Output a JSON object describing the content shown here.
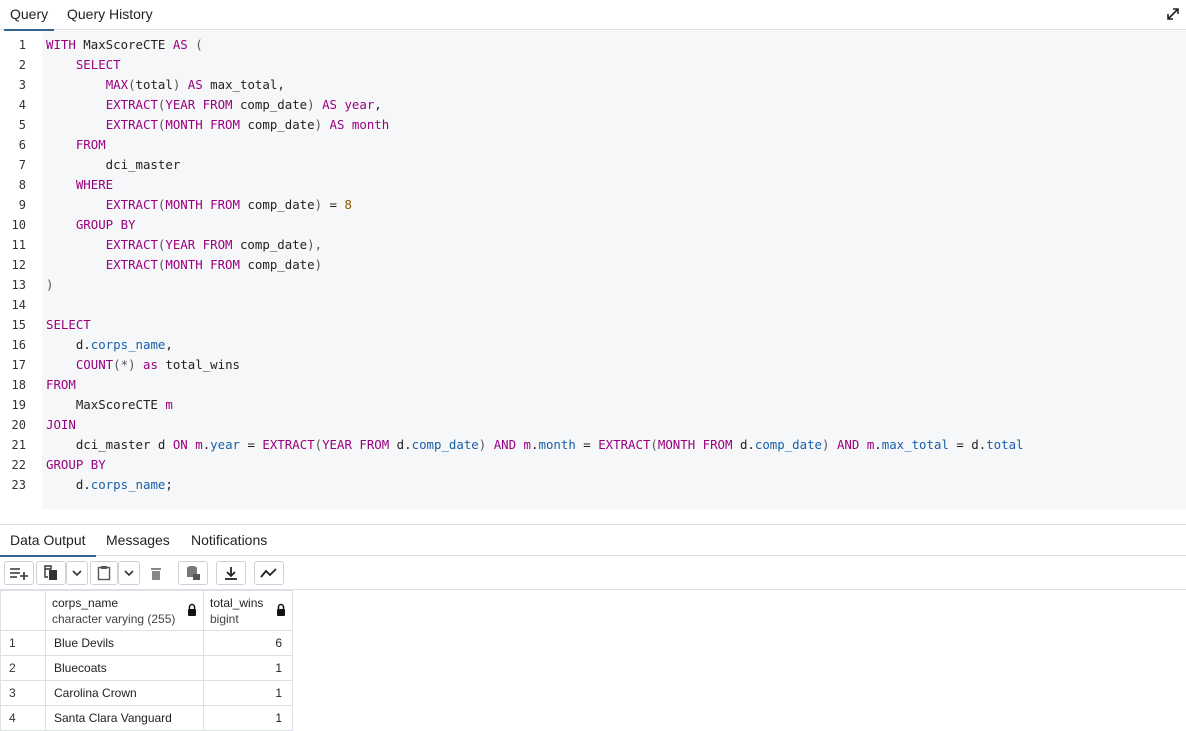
{
  "top_tabs": [
    "Query",
    "Query History"
  ],
  "editor": {
    "lines": [
      {
        "n": "1",
        "tokens": [
          [
            "kw",
            "WITH"
          ],
          [
            "t",
            " MaxScoreCTE "
          ],
          [
            "kw",
            "AS"
          ],
          [
            "p",
            " ("
          ]
        ]
      },
      {
        "n": "2",
        "tokens": [
          [
            "t",
            "    "
          ],
          [
            "kw",
            "SELECT"
          ]
        ]
      },
      {
        "n": "3",
        "tokens": [
          [
            "t",
            "        "
          ],
          [
            "kw",
            "MAX"
          ],
          [
            "p",
            "("
          ],
          [
            "t",
            "total"
          ],
          [
            "p",
            ")"
          ],
          [
            "t",
            " "
          ],
          [
            "kw",
            "AS"
          ],
          [
            "t",
            " max_total,"
          ]
        ]
      },
      {
        "n": "4",
        "tokens": [
          [
            "t",
            "        "
          ],
          [
            "kw",
            "EXTRACT"
          ],
          [
            "p",
            "("
          ],
          [
            "kw",
            "YEAR FROM"
          ],
          [
            "t",
            " comp_date"
          ],
          [
            "p",
            ")"
          ],
          [
            "t",
            " "
          ],
          [
            "kw",
            "AS"
          ],
          [
            "t",
            " "
          ],
          [
            "kw",
            "year"
          ],
          [
            "t",
            ","
          ]
        ]
      },
      {
        "n": "5",
        "tokens": [
          [
            "t",
            "        "
          ],
          [
            "kw",
            "EXTRACT"
          ],
          [
            "p",
            "("
          ],
          [
            "kw",
            "MONTH FROM"
          ],
          [
            "t",
            " comp_date"
          ],
          [
            "p",
            ")"
          ],
          [
            "t",
            " "
          ],
          [
            "kw",
            "AS"
          ],
          [
            "t",
            " "
          ],
          [
            "kw",
            "month"
          ]
        ]
      },
      {
        "n": "6",
        "tokens": [
          [
            "t",
            "    "
          ],
          [
            "kw",
            "FROM"
          ]
        ]
      },
      {
        "n": "7",
        "tokens": [
          [
            "t",
            "        dci_master"
          ]
        ]
      },
      {
        "n": "8",
        "tokens": [
          [
            "t",
            "    "
          ],
          [
            "kw",
            "WHERE"
          ]
        ]
      },
      {
        "n": "9",
        "tokens": [
          [
            "t",
            "        "
          ],
          [
            "kw",
            "EXTRACT"
          ],
          [
            "p",
            "("
          ],
          [
            "kw",
            "MONTH FROM"
          ],
          [
            "t",
            " comp_date"
          ],
          [
            "p",
            ")"
          ],
          [
            "t",
            " = "
          ],
          [
            "num",
            "8"
          ]
        ]
      },
      {
        "n": "10",
        "tokens": [
          [
            "t",
            "    "
          ],
          [
            "kw",
            "GROUP BY"
          ]
        ]
      },
      {
        "n": "11",
        "tokens": [
          [
            "t",
            "        "
          ],
          [
            "kw",
            "EXTRACT"
          ],
          [
            "p",
            "("
          ],
          [
            "kw",
            "YEAR FROM"
          ],
          [
            "t",
            " comp_date"
          ],
          [
            "p",
            "),"
          ]
        ]
      },
      {
        "n": "12",
        "tokens": [
          [
            "t",
            "        "
          ],
          [
            "kw",
            "EXTRACT"
          ],
          [
            "p",
            "("
          ],
          [
            "kw",
            "MONTH FROM"
          ],
          [
            "t",
            " comp_date"
          ],
          [
            "p",
            ")"
          ]
        ]
      },
      {
        "n": "13",
        "tokens": [
          [
            "p",
            ")"
          ]
        ]
      },
      {
        "n": "14",
        "tokens": []
      },
      {
        "n": "15",
        "tokens": [
          [
            "kw",
            "SELECT"
          ]
        ]
      },
      {
        "n": "16",
        "tokens": [
          [
            "t",
            "    d."
          ],
          [
            "fld",
            "corps_name"
          ],
          [
            "t",
            ","
          ]
        ]
      },
      {
        "n": "17",
        "tokens": [
          [
            "t",
            "    "
          ],
          [
            "kw",
            "COUNT"
          ],
          [
            "p",
            "(*)"
          ],
          [
            "t",
            " "
          ],
          [
            "kw",
            "as"
          ],
          [
            "t",
            " total_wins"
          ]
        ]
      },
      {
        "n": "18",
        "tokens": [
          [
            "kw",
            "FROM"
          ]
        ]
      },
      {
        "n": "19",
        "tokens": [
          [
            "t",
            "    MaxScoreCTE "
          ],
          [
            "kw",
            "m"
          ]
        ]
      },
      {
        "n": "20",
        "tokens": [
          [
            "kw",
            "JOIN"
          ]
        ]
      },
      {
        "n": "21",
        "tokens": [
          [
            "t",
            "    dci_master d "
          ],
          [
            "kw",
            "ON"
          ],
          [
            "t",
            " "
          ],
          [
            "kw",
            "m"
          ],
          [
            "t",
            "."
          ],
          [
            "fld",
            "year"
          ],
          [
            "t",
            " = "
          ],
          [
            "kw",
            "EXTRACT"
          ],
          [
            "p",
            "("
          ],
          [
            "kw",
            "YEAR FROM"
          ],
          [
            "t",
            " d."
          ],
          [
            "fld",
            "comp_date"
          ],
          [
            "p",
            ")"
          ],
          [
            "t",
            " "
          ],
          [
            "kw",
            "AND"
          ],
          [
            "t",
            " "
          ],
          [
            "kw",
            "m"
          ],
          [
            "t",
            "."
          ],
          [
            "fld",
            "month"
          ],
          [
            "t",
            " = "
          ],
          [
            "kw",
            "EXTRACT"
          ],
          [
            "p",
            "("
          ],
          [
            "kw",
            "MONTH FROM"
          ],
          [
            "t",
            " d."
          ],
          [
            "fld",
            "comp_date"
          ],
          [
            "p",
            ")"
          ],
          [
            "t",
            " "
          ],
          [
            "kw",
            "AND"
          ],
          [
            "t",
            " "
          ],
          [
            "kw",
            "m"
          ],
          [
            "t",
            "."
          ],
          [
            "fld",
            "max_total"
          ],
          [
            "t",
            " = d."
          ],
          [
            "fld",
            "total"
          ]
        ]
      },
      {
        "n": "22",
        "tokens": [
          [
            "kw",
            "GROUP BY"
          ]
        ]
      },
      {
        "n": "23",
        "tokens": [
          [
            "t",
            "    d."
          ],
          [
            "fld",
            "corps_name"
          ],
          [
            "t",
            ";"
          ]
        ]
      }
    ]
  },
  "bottom_tabs": [
    "Data Output",
    "Messages",
    "Notifications"
  ],
  "toolbar_icons": [
    "add-row-icon",
    "copy-icon",
    "copy-dropdown-icon",
    "paste-icon",
    "paste-dropdown-icon",
    "delete-icon",
    "save-data-icon",
    "download-icon",
    "graph-icon"
  ],
  "grid": {
    "columns": [
      {
        "name": "corps_name",
        "type": "character varying (255)"
      },
      {
        "name": "total_wins",
        "type": "bigint"
      }
    ],
    "rows": [
      {
        "n": "1",
        "corps_name": "Blue Devils",
        "total_wins": "6"
      },
      {
        "n": "2",
        "corps_name": "Bluecoats",
        "total_wins": "1"
      },
      {
        "n": "3",
        "corps_name": "Carolina Crown",
        "total_wins": "1"
      },
      {
        "n": "4",
        "corps_name": "Santa Clara Vanguard",
        "total_wins": "1"
      }
    ]
  },
  "colors": {
    "accent": "#326690",
    "keyword": "#990080",
    "field": "#1a5fa8",
    "number": "#8a5a00"
  }
}
